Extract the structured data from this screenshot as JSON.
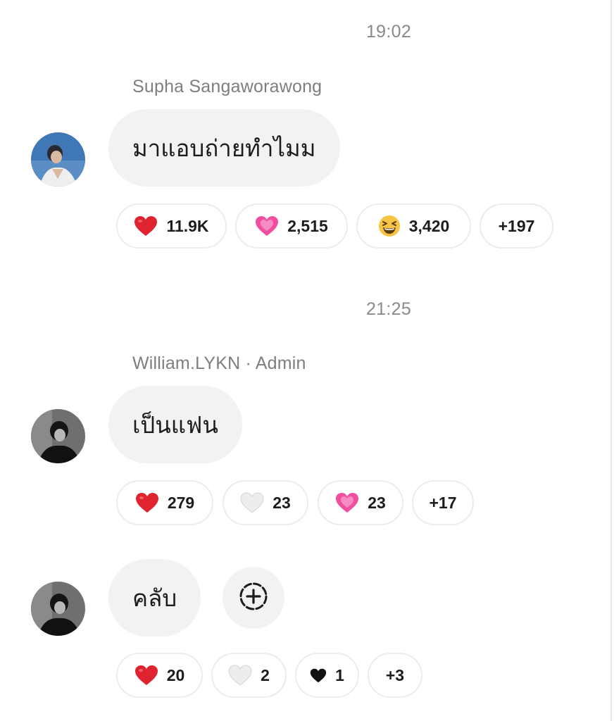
{
  "messages": [
    {
      "timestamp": "19:02",
      "sender": "Supha Sangaworawong",
      "text": "มาแอบถ่ายทำไมม",
      "reactions": [
        {
          "icon": "red-heart-icon",
          "count": "11.9K"
        },
        {
          "icon": "pink-sparkling-heart-icon",
          "count": "2,515"
        },
        {
          "icon": "grinning-squinting-face-icon",
          "count": "3,420"
        },
        {
          "label": "+197"
        }
      ]
    },
    {
      "timestamp": "21:25",
      "sender": "William.LYKN · Admin",
      "text": "เป็นแฟน",
      "reactions": [
        {
          "icon": "red-heart-icon",
          "count": "279"
        },
        {
          "icon": "white-heart-icon",
          "count": "23"
        },
        {
          "icon": "pink-sparkling-heart-icon",
          "count": "23"
        },
        {
          "label": "+17"
        }
      ]
    },
    {
      "text": "คลับ",
      "reactions": [
        {
          "icon": "red-heart-icon",
          "count": "20"
        },
        {
          "icon": "white-heart-icon",
          "count": "2"
        },
        {
          "icon": "black-heart-icon",
          "count": "1"
        },
        {
          "label": "+3"
        }
      ]
    }
  ],
  "colors": {
    "bubble_bg": "#f2f2f4",
    "meta_text": "#8a8a8e",
    "red_heart": "#e0242f",
    "pink_heart": "#f04fa0"
  }
}
